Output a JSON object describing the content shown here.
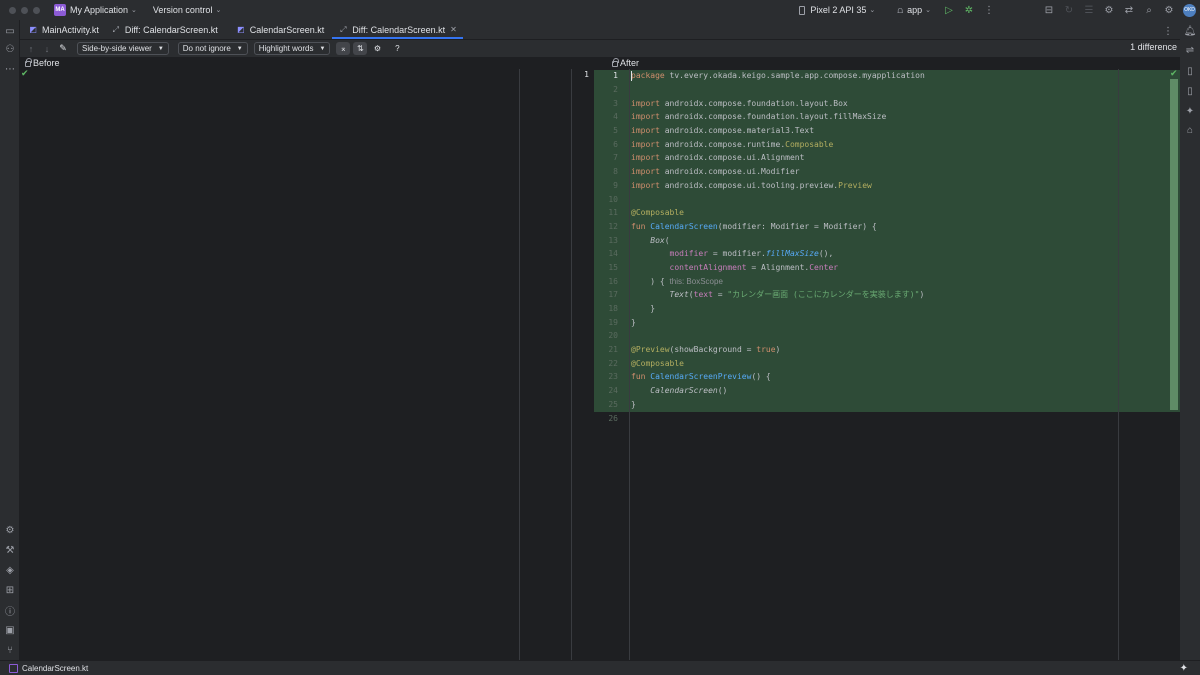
{
  "titlebar": {
    "project_badge": "MA",
    "project_name": "My Application",
    "vcs": "Version control",
    "device": "Pixel 2 API 35",
    "run_config": "app",
    "avatar": "OKD"
  },
  "tabs": [
    {
      "label": "MainActivity.kt"
    },
    {
      "label": "Diff: CalendarScreen.kt"
    },
    {
      "label": "CalendarScreen.kt"
    },
    {
      "label": "Diff: CalendarScreen.kt",
      "active": true
    }
  ],
  "toolbar": {
    "viewer": "Side-by-side viewer",
    "ignore": "Do not ignore",
    "highlight": "Highlight words",
    "diff_count": "1 difference"
  },
  "panes": {
    "before": "Before",
    "after": "After",
    "left_line_number": "1"
  },
  "code": {
    "line_numbers": [
      "1",
      "2",
      "3",
      "4",
      "5",
      "6",
      "7",
      "8",
      "9",
      "10",
      "11",
      "12",
      "13",
      "14",
      "15",
      "16",
      "17",
      "18",
      "19",
      "20",
      "21",
      "22",
      "23",
      "24",
      "25",
      "26"
    ],
    "l1": [
      "package",
      " tv.every.okada.keigo.sample.app.compose.myapplication"
    ],
    "l3": [
      "import",
      " androidx.compose.foundation.layout.Box"
    ],
    "l4": [
      "import",
      " androidx.compose.foundation.layout.fillMaxSize"
    ],
    "l5": [
      "import",
      " androidx.compose.material3.Text"
    ],
    "l6": [
      "import",
      " androidx.compose.runtime.",
      "Composable"
    ],
    "l7": [
      "import",
      " androidx.compose.ui.Alignment"
    ],
    "l8": [
      "import",
      " androidx.compose.ui.Modifier"
    ],
    "l9": [
      "import",
      " androidx.compose.ui.tooling.preview.",
      "Preview"
    ],
    "l11": [
      "@Composable"
    ],
    "l12": [
      "fun",
      " ",
      "CalendarScreen",
      "(modifier: Modifier = Modifier) {"
    ],
    "l13": [
      "    ",
      "Box",
      "("
    ],
    "l14": [
      "        ",
      "modifier",
      " = modifier.",
      "fillMaxSize",
      "(),"
    ],
    "l15": [
      "        ",
      "contentAlignment",
      " = Alignment.",
      "Center"
    ],
    "l16": [
      "    ) { ",
      "this: BoxScope"
    ],
    "l17": [
      "        ",
      "Text",
      "(",
      "text",
      " = ",
      "\"カレンダー画面 (ここにカレンダーを実装します)\"",
      ")"
    ],
    "l18": [
      "    }"
    ],
    "l19": [
      "}"
    ],
    "l21": [
      "@Preview",
      "(",
      "showBackground",
      " = ",
      "true",
      ")"
    ],
    "l22": [
      "@Composable"
    ],
    "l23": [
      "fun",
      " ",
      "CalendarScreenPreview",
      "() {"
    ],
    "l24": [
      "    ",
      "CalendarScreen",
      "()"
    ],
    "l25": [
      "}"
    ]
  },
  "status": {
    "file": "CalendarScreen.kt"
  }
}
